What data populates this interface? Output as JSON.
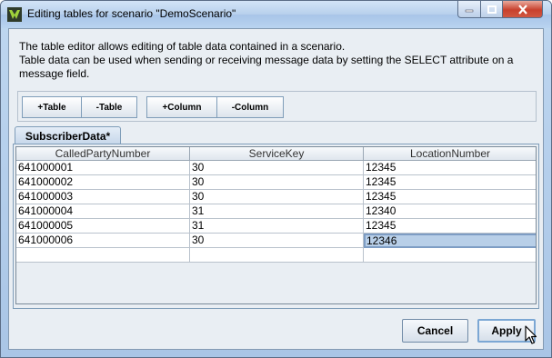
{
  "window": {
    "title": "Editing tables for scenario \"DemoScenario\"",
    "icons": [
      "app-icon",
      "minimize-icon",
      "maximize-icon",
      "close-icon"
    ]
  },
  "description": {
    "line1": "The table editor allows editing of table data contained in a scenario.",
    "line2": "Table data can be used when sending or receiving message data by setting the SELECT attribute on a message field."
  },
  "toolbar": {
    "add_table": "+Table",
    "remove_table": "-Table",
    "add_column": "+Column",
    "remove_column": "-Column"
  },
  "tab": {
    "label": "SubscriberData*"
  },
  "table": {
    "columns": [
      "CalledPartyNumber",
      "ServiceKey",
      "LocationNumber"
    ],
    "rows": [
      [
        "641000001",
        "30",
        "12345"
      ],
      [
        "641000002",
        "30",
        "12345"
      ],
      [
        "641000003",
        "30",
        "12345"
      ],
      [
        "641000004",
        "31",
        "12340"
      ],
      [
        "641000005",
        "31",
        "12345"
      ],
      [
        "641000006",
        "30",
        "12346"
      ],
      [
        "",
        "",
        ""
      ]
    ],
    "selected_cell": "row 6, LocationNumber"
  },
  "buttons": {
    "cancel": "Cancel",
    "apply": "Apply"
  },
  "colors": {
    "selection": "#b8cfe8",
    "frame": "#a9c5e6"
  }
}
